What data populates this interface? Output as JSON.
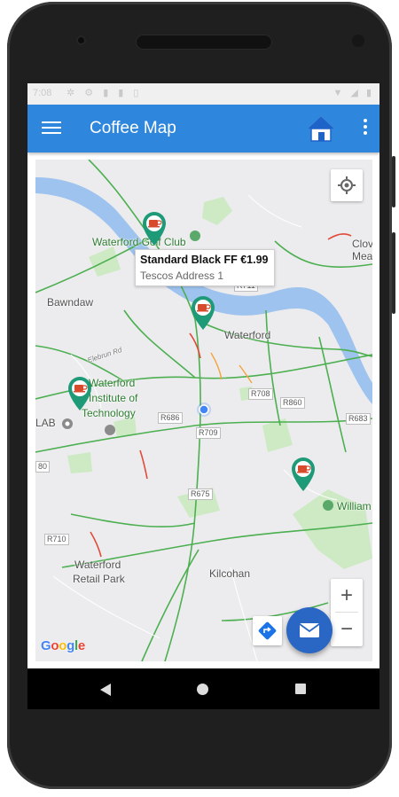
{
  "statusbar": {
    "time": "7:08",
    "system_icons": "✲ ⚙ ▮ ▮ ▯",
    "right_icons": "▼ ◢ ▮"
  },
  "appbar": {
    "title": "Coffee Map"
  },
  "map": {
    "places": [
      {
        "key": "golf",
        "text": "Waterford Golf Club"
      },
      {
        "key": "clov",
        "text": "Clov\nMead"
      },
      {
        "key": "bawndaw",
        "text": "Bawndaw"
      },
      {
        "key": "waterford",
        "text": "Waterford"
      },
      {
        "key": "wit1",
        "text": "Waterford"
      },
      {
        "key": "wit2",
        "text": "Institute of"
      },
      {
        "key": "wit3",
        "text": "Technology"
      },
      {
        "key": "lab",
        "text": "LAB"
      },
      {
        "key": "william",
        "text": "William"
      },
      {
        "key": "retail1",
        "text": "Waterford"
      },
      {
        "key": "retail2",
        "text": "Retail Park"
      },
      {
        "key": "kilcohan",
        "text": "Kilcohan"
      },
      {
        "key": "elebrun",
        "text": "Elebrun Rd"
      }
    ],
    "roads": [
      "R711",
      "R708",
      "R860",
      "R686",
      "R709",
      "R683",
      "R675",
      "R710",
      "80"
    ],
    "info_window": {
      "title": "Standard Black FF €1.99",
      "subtitle": "Tescos Address 1"
    },
    "attribution": "Google",
    "zoom_in": "+",
    "zoom_out": "−",
    "pins": [
      "coffee-cup",
      "coffee-cup",
      "coffee-cup",
      "coffee-cup"
    ]
  },
  "colors": {
    "appbar": "#2f86dd",
    "fab": "#2a67c4",
    "pin": "#1f9a78",
    "water": "#9ec3ee",
    "road_green": "#4caf50"
  }
}
